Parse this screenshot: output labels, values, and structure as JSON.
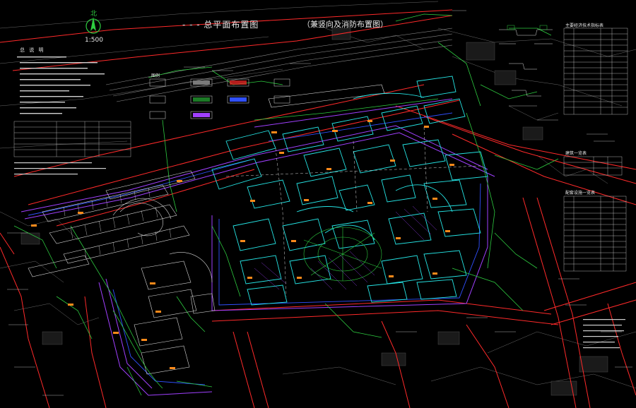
{
  "drawing": {
    "title_main": "- - - 总平面布置图",
    "title_sub": "（兼竖向及消防布置图）",
    "scale": "1:500",
    "north_label": "北"
  },
  "notes": {
    "header": "总 说 明"
  },
  "tables": {
    "econ_header": "主要经济技术指标表",
    "legend_header": "图例",
    "table2_header": "建筑一览表",
    "table3_header": "配套设施一览表"
  },
  "colors": {
    "background": "#000000",
    "road": "#ff2a2a",
    "building": "#25e5e5",
    "green": "#2ecc40",
    "purple": "#a040ff",
    "blue": "#3050ff",
    "white": "#d8d8d8",
    "label": "#ff8a1a",
    "grey": "#7a7a7a"
  }
}
